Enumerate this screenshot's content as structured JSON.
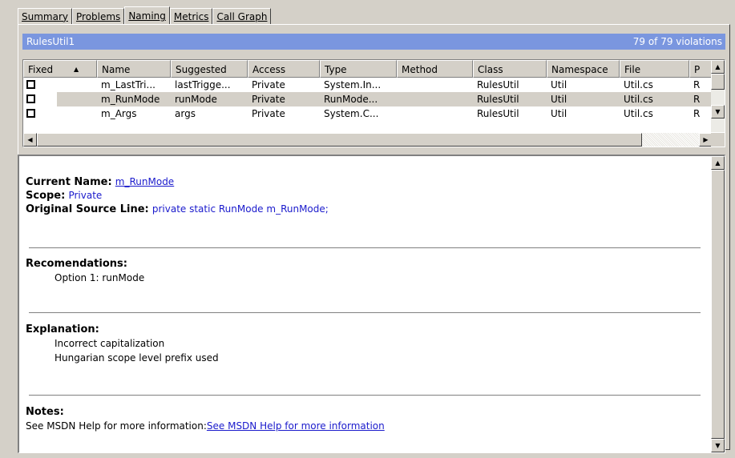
{
  "tabs": [
    {
      "label": "Summary"
    },
    {
      "label": "Problems"
    },
    {
      "label": "Naming",
      "active": true
    },
    {
      "label": "Metrics"
    },
    {
      "label": "Call Graph"
    }
  ],
  "titlebar": {
    "title": "RulesUtil1",
    "count": "79 of 79 violations",
    "color": "#7a96df"
  },
  "grid": {
    "columns": [
      "Fixed",
      "Name",
      "Suggested",
      "Access",
      "Type",
      "Method",
      "Class",
      "Namespace",
      "File",
      "P"
    ],
    "rows": [
      {
        "fixed": false,
        "name": "m_LastTri...",
        "suggested": "lastTrigge...",
        "access": "Private",
        "type": "System.In...",
        "method": "",
        "class": "RulesUtil",
        "namespace": "Util",
        "file": "Util.cs",
        "p": "R"
      },
      {
        "fixed": false,
        "name": "m_RunMode",
        "suggested": "runMode",
        "access": "Private",
        "type": "RunMode...",
        "method": "",
        "class": "RulesUtil",
        "namespace": "Util",
        "file": "Util.cs",
        "p": "R",
        "selected": true
      },
      {
        "fixed": false,
        "name": "m_Args",
        "suggested": "args",
        "access": "Private",
        "type": "System.C...",
        "method": "",
        "class": "RulesUtil",
        "namespace": "Util",
        "file": "Util.cs",
        "p": "R"
      }
    ]
  },
  "detail": {
    "current_name_label": "Current Name:",
    "current_name": "m_RunMode",
    "scope_label": "Scope:",
    "scope": "Private",
    "source_label": "Original Source Line:",
    "source": "private static RunMode m_RunMode;",
    "recommendations_label": "Recomendations:",
    "recommendations": [
      "Option 1: runMode"
    ],
    "explanation_label": "Explanation:",
    "explanation": [
      "Incorrect capitalization",
      "Hungarian scope level prefix used"
    ],
    "notes_label": "Notes:",
    "notes_text": "See MSDN Help for more information:",
    "notes_link": "See MSDN Help for more information"
  }
}
